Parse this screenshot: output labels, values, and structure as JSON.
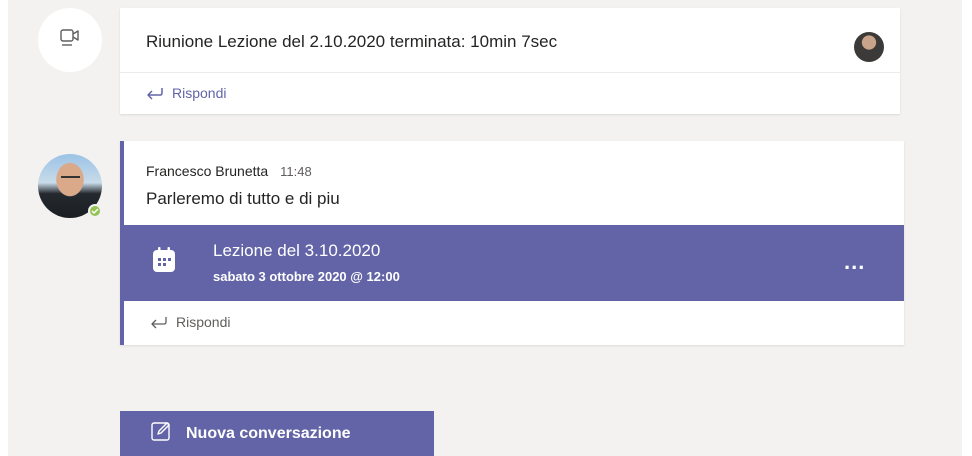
{
  "meeting": {
    "icon": "video-camera-icon",
    "text": "Riunione Lezione del 2.10.2020 terminata: 10min 7sec",
    "reply_label": "Rispondi"
  },
  "post": {
    "author": "Francesco Brunetta",
    "time": "11:48",
    "body": "Parleremo di tutto e di piu",
    "presence": "available",
    "event": {
      "icon": "calendar-icon",
      "title": "Lezione del 3.10.2020",
      "subtitle": "sabato 3 ottobre 2020 @ 12:00",
      "more": "..."
    },
    "reply_label": "Rispondi"
  },
  "new_conversation": {
    "label": "Nuova conversazione",
    "icon": "compose-icon"
  },
  "colors": {
    "accent": "#6264a7",
    "background": "#f3f2f1",
    "presence_available": "#92c353"
  }
}
